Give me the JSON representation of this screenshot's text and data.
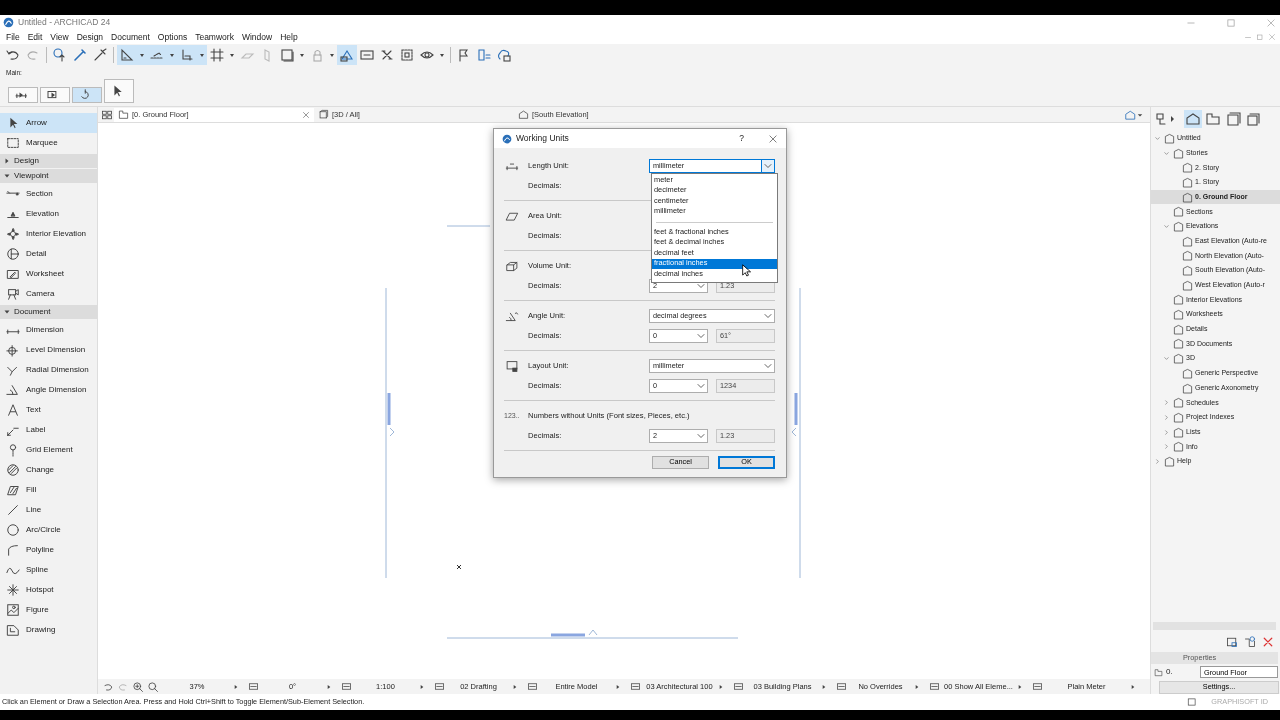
{
  "window": {
    "title": "Untitled - ARCHICAD 24"
  },
  "menu": [
    "File",
    "Edit",
    "View",
    "Design",
    "Document",
    "Options",
    "Teamwork",
    "Window",
    "Help"
  ],
  "toolbar": [
    {
      "on": false
    },
    {
      "on": false
    },
    {
      "on": false
    },
    {
      "on": false
    },
    {
      "on": false
    },
    {
      "on": true
    },
    {
      "on": true
    },
    {
      "on": true
    },
    {
      "on": true
    },
    {
      "on": true
    },
    {
      "on": true
    },
    {
      "on": false
    },
    {
      "on": false
    },
    {
      "on": false
    },
    {
      "on": false
    },
    {
      "on": false
    },
    {
      "on": false
    },
    {
      "on": false
    },
    {
      "on": false
    },
    {
      "on": true
    },
    {
      "on": false
    },
    {
      "on": false
    },
    {
      "on": false
    },
    {
      "on": false
    },
    {
      "on": false
    },
    {
      "on": false
    },
    {
      "on": false
    },
    {
      "on": false
    }
  ],
  "toolbar_label": "Main:",
  "toolbar2": [
    {
      "on": false
    },
    {
      "on": false
    },
    {
      "on": true
    },
    {
      "on": false
    }
  ],
  "toolbox": [
    {
      "kind": "tool",
      "label": "Arrow",
      "selected": true
    },
    {
      "kind": "tool",
      "label": "Marquee",
      "selected": false
    },
    {
      "kind": "section",
      "label": "Design",
      "expanded": false
    },
    {
      "kind": "section",
      "label": "Viewpoint",
      "expanded": true
    },
    {
      "kind": "tool",
      "label": "Section",
      "selected": false
    },
    {
      "kind": "tool",
      "label": "Elevation",
      "selected": false
    },
    {
      "kind": "tool",
      "label": "Interior Elevation",
      "selected": false
    },
    {
      "kind": "tool",
      "label": "Detail",
      "selected": false
    },
    {
      "kind": "tool",
      "label": "Worksheet",
      "selected": false
    },
    {
      "kind": "tool",
      "label": "Camera",
      "selected": false
    },
    {
      "kind": "section",
      "label": "Document",
      "expanded": true
    },
    {
      "kind": "tool",
      "label": "Dimension",
      "selected": false
    },
    {
      "kind": "tool",
      "label": "Level Dimension",
      "selected": false
    },
    {
      "kind": "tool",
      "label": "Radial Dimension",
      "selected": false
    },
    {
      "kind": "tool",
      "label": "Angle Dimension",
      "selected": false
    },
    {
      "kind": "tool",
      "label": "Text",
      "selected": false
    },
    {
      "kind": "tool",
      "label": "Label",
      "selected": false
    },
    {
      "kind": "tool",
      "label": "Grid Element",
      "selected": false
    },
    {
      "kind": "tool",
      "label": "Change",
      "selected": false
    },
    {
      "kind": "tool",
      "label": "Fill",
      "selected": false
    },
    {
      "kind": "tool",
      "label": "Line",
      "selected": false
    },
    {
      "kind": "tool",
      "label": "Arc/Circle",
      "selected": false
    },
    {
      "kind": "tool",
      "label": "Polyline",
      "selected": false
    },
    {
      "kind": "tool",
      "label": "Spline",
      "selected": false
    },
    {
      "kind": "tool",
      "label": "Hotspot",
      "selected": false
    },
    {
      "kind": "tool",
      "label": "Figure",
      "selected": false
    },
    {
      "kind": "tool",
      "label": "Drawing",
      "selected": false
    }
  ],
  "view_tabs": [
    {
      "label": "[0. Ground Floor]",
      "selected": true
    },
    {
      "label": "[3D / All]",
      "selected": false
    },
    {
      "label": "[South Elevation]",
      "selected": false
    }
  ],
  "dialog": {
    "title": "Working Units",
    "help_button": "?",
    "sections": [
      {
        "label": "Length Unit:",
        "unit": "millimeter",
        "open": true,
        "decimals_label": "Decimals:"
      },
      {
        "label": "Area Unit:",
        "decimals_label": "Decimals:"
      },
      {
        "label": "Volume Unit:",
        "decimals_label": "Decimals:",
        "decimals": "2",
        "sample": "1.23"
      },
      {
        "label": "Angle Unit:",
        "unit": "decimal degrees",
        "open": false,
        "decimals_label": "Decimals:",
        "decimals": "0",
        "sample": "61°"
      },
      {
        "label": "Layout Unit:",
        "unit": "millimeter",
        "open": false,
        "decimals_label": "Decimals:",
        "decimals": "0",
        "sample": "1234"
      },
      {
        "prefix": "123..",
        "label": "Numbers without Units (Font sizes, Pieces, etc.)",
        "decimals_label": "Decimals:",
        "decimals": "2",
        "sample": "1.23"
      }
    ],
    "option_groups": [
      {
        "options": [
          {
            "label": "meter",
            "selected": false
          },
          {
            "label": "decimeter",
            "selected": false
          },
          {
            "label": "centimeter",
            "selected": false
          },
          {
            "label": "millimeter",
            "selected": false
          }
        ]
      },
      {
        "options": [
          {
            "label": "feet & fractional inches",
            "selected": false
          },
          {
            "label": "feet & decimal inches",
            "selected": false
          },
          {
            "label": "decimal feet",
            "selected": false
          },
          {
            "label": "fractional inches",
            "selected": true
          },
          {
            "label": "decimal inches",
            "selected": false
          }
        ]
      }
    ],
    "buttons": [
      {
        "label": "Cancel",
        "default": false
      },
      {
        "label": "OK",
        "default": true
      }
    ]
  },
  "navigator": {
    "tabs": [
      {
        "selected": false
      },
      {
        "selected": true
      },
      {
        "selected": false
      },
      {
        "selected": false
      },
      {
        "selected": false
      }
    ],
    "tree": [
      {
        "label": "Untitled",
        "expanded": true,
        "selected": false,
        "children": [
          {
            "label": "Stories",
            "expanded": true,
            "selected": false,
            "children": [
              {
                "label": "2. Story",
                "selected": false
              },
              {
                "label": "1. Story",
                "selected": false
              },
              {
                "label": "0. Ground Floor",
                "selected": true
              }
            ]
          },
          {
            "label": "Sections",
            "selected": false
          },
          {
            "label": "Elevations",
            "expanded": true,
            "selected": false,
            "children": [
              {
                "label": "East Elevation (Auto-re",
                "selected": false
              },
              {
                "label": "North Elevation (Auto-",
                "selected": false
              },
              {
                "label": "South Elevation (Auto-",
                "selected": false
              },
              {
                "label": "West Elevation (Auto-r",
                "selected": false
              }
            ]
          },
          {
            "label": "Interior Elevations",
            "selected": false
          },
          {
            "label": "Worksheets",
            "selected": false
          },
          {
            "label": "Details",
            "selected": false
          },
          {
            "label": "3D Documents",
            "selected": false
          },
          {
            "label": "3D",
            "expanded": true,
            "selected": false,
            "children": [
              {
                "label": "Generic Perspective",
                "selected": false
              },
              {
                "label": "Generic Axonometry",
                "selected": false
              }
            ]
          },
          {
            "label": "Schedules",
            "expanded": false,
            "selected": false
          },
          {
            "label": "Project Indexes",
            "expanded": false,
            "selected": false
          },
          {
            "label": "Lists",
            "expanded": false,
            "selected": false
          },
          {
            "label": "Info",
            "expanded": false,
            "selected": false
          }
        ]
      },
      {
        "label": "Help",
        "expanded": false,
        "selected": false
      }
    ]
  },
  "properties": {
    "title": "Properties",
    "story_number": "0.",
    "story_name": "Ground Floor",
    "settings_button": "Settings..."
  },
  "view_bar": [
    "37%",
    "0°",
    "1:100",
    "02 Drafting",
    "Entire Model",
    "03 Architectural 100",
    "03 Building Plans",
    "No Overrides",
    "00 Show All Eleme...",
    "Plain Meter"
  ],
  "status_text": "Click an Element or Draw a Selection Area. Press and Hold Ctrl+Shift to Toggle Element/Sub-Element Selection.",
  "brand": "GRAPHISOFT ID"
}
